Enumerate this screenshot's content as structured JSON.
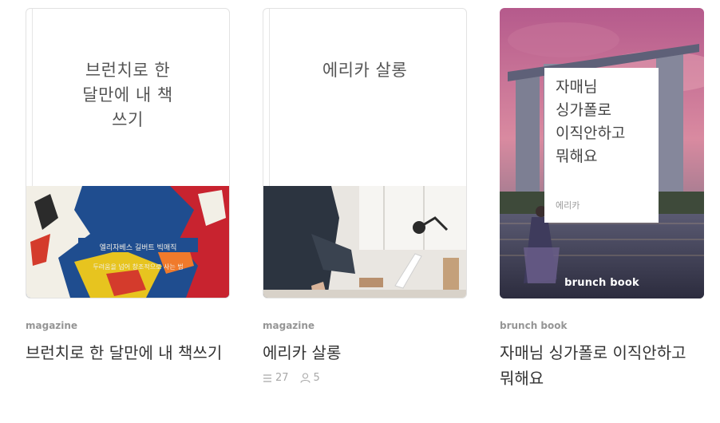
{
  "cards": [
    {
      "cover_title": "브런치로 한\n달만에 내 책\n쓰기",
      "art_text_1": "엘리자베스 길버트 빅매직",
      "art_text_2": "두려움을 넘어 창조적으로 사는 법",
      "kind": "magazine",
      "title": "브런치로 한 달만에 내 책쓰기"
    },
    {
      "cover_title": "에리카 살롱",
      "kind": "magazine",
      "title": "에리카 살롱",
      "stats": {
        "articles": "27",
        "subscribers": "5"
      }
    },
    {
      "cover_title": "자매님\n싱가폴로\n이직안하고\n뭐해요",
      "cover_author": "에리카",
      "cover_brand": "brunch book",
      "kind": "brunch book",
      "title": "자매님 싱가폴로 이직안하고 뭐해요"
    }
  ],
  "icons": {
    "articles": "list-icon",
    "subscribers": "person-icon"
  }
}
